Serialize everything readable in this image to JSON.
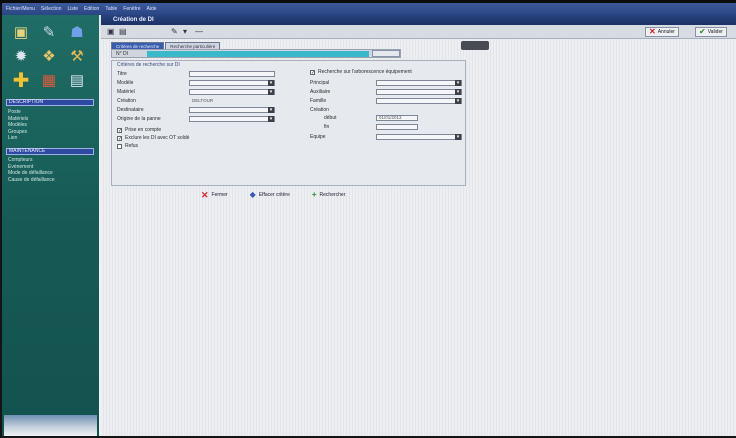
{
  "menubar": [
    "Fichier/Menu",
    "Sélection",
    "Liste",
    "Edition",
    "Table",
    "Fenêtre",
    "Aide"
  ],
  "window": {
    "title": "Création de DI"
  },
  "toolbar": {
    "cancel": "Annuler",
    "validate": "Valider"
  },
  "tabs": [
    "Critères de recherche",
    "Recherche particulière"
  ],
  "nof": {
    "label": "N° DI"
  },
  "criteria": {
    "title": "Critères de recherche sur DI",
    "left_fields": [
      {
        "label": "Titre",
        "value": "",
        "select": false
      },
      {
        "label": "Modèle",
        "value": "",
        "select": true
      },
      {
        "label": "Matériel",
        "value": "",
        "select": true
      },
      {
        "label": "Création",
        "value": "DELTOUR",
        "select": false
      },
      {
        "label": "Destinataire",
        "value": "",
        "select": true
      },
      {
        "label": "Origine de la panne",
        "value": "",
        "select": true
      }
    ],
    "checks": [
      {
        "label": "Prise en compte",
        "checked": true
      },
      {
        "label": "Exclure les DI avec OT soldé",
        "checked": true
      },
      {
        "label": "Refus",
        "checked": false
      }
    ],
    "right_check": "Recherche sur l'arborescence équipement",
    "right_fields": [
      {
        "label": "Principal",
        "value": "",
        "select": true
      },
      {
        "label": "Auxiliaire",
        "value": "",
        "select": true
      },
      {
        "label": "Famille",
        "value": "",
        "select": true
      }
    ],
    "creation_label": "Création",
    "debut_label": "début",
    "debut_value": "01/01/2013",
    "fin_label": "fin",
    "fin_value": "",
    "equipe_label": "Equipe",
    "equipe_value": ""
  },
  "actions": {
    "close": "Fermer",
    "clear": "Effacer critère",
    "search": "Rechercher"
  },
  "sidebar": {
    "section1": "DESCRIPTION",
    "list1": [
      "Poste",
      "Matériels",
      "Modèles",
      "Groupes",
      "Lien"
    ],
    "section2": "MAINTENANCE",
    "list2": [
      "Compteurs",
      "Evènement",
      "Mode de défaillance",
      "Cause de défaillance"
    ]
  }
}
